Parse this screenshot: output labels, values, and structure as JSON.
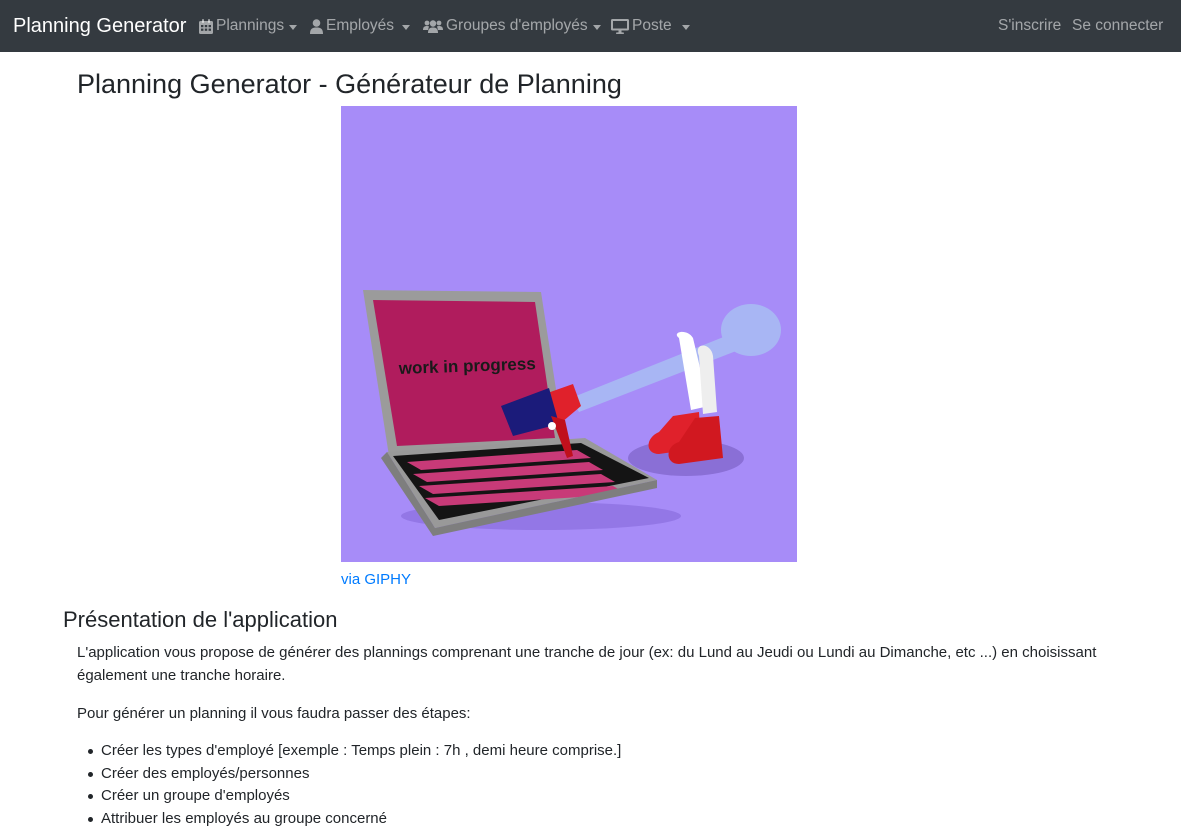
{
  "navbar": {
    "brand": "Planning Generator",
    "menus": [
      {
        "label": "Plannings",
        "icon": "calendar-icon"
      },
      {
        "label": "Employés",
        "icon": "user-icon"
      },
      {
        "label": "Groupes d'employés",
        "icon": "users-icon"
      },
      {
        "label": "Poste",
        "icon": "desktop-icon"
      }
    ],
    "register": "S'inscrire",
    "login": "Se connecter"
  },
  "main": {
    "title": "Planning Generator - Générateur de Planning",
    "gif": {
      "screen_text": "work in progress",
      "background_color": "#a78cf8"
    },
    "gif_credit": "via GIPHY",
    "section_title": "Présentation de l'application",
    "intro": "L'application vous propose de générer des plannings comprenant une tranche de jour (ex: du Lund au Jeudi ou Lundi au Dimanche, etc ...) en choisissant également une tranche horaire.",
    "steps_intro": "Pour générer un planning il vous faudra passer des étapes:",
    "steps": [
      "Créer les types d'employé [exemple : Temps plein : 7h , demi heure comprise.]",
      "Créer des employés/personnes",
      "Créer un groupe d'employés",
      "Attribuer les employés au groupe concerné"
    ]
  }
}
